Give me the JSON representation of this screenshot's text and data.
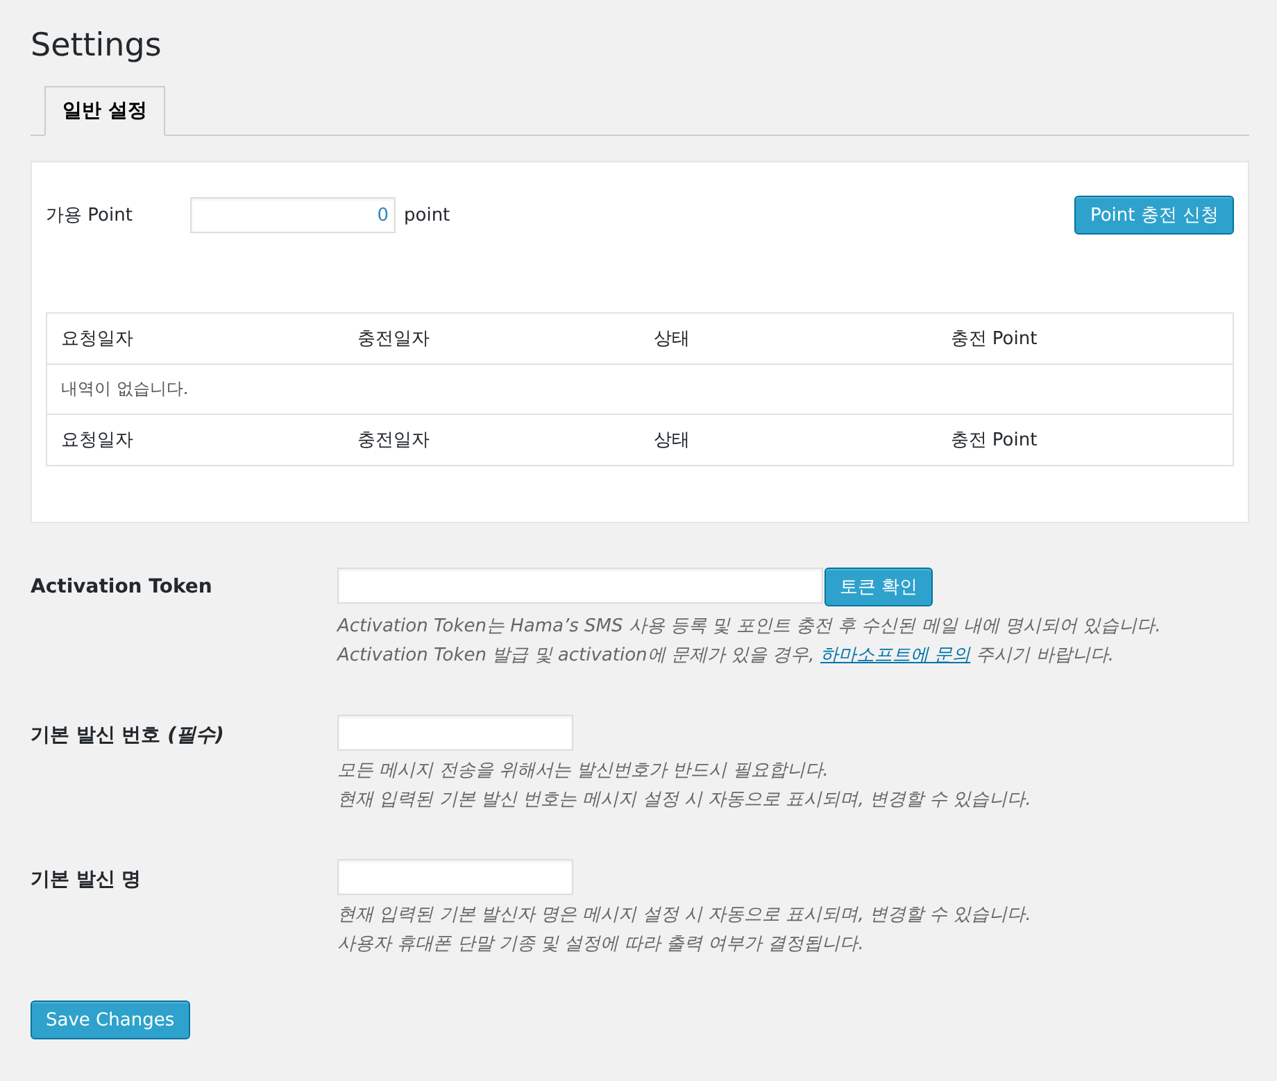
{
  "title": "Settings",
  "tabs": [
    {
      "label": "일반 설정",
      "selected": true
    }
  ],
  "points": {
    "label": "가용 Point",
    "value": "0",
    "unit": "point",
    "button": "Point 충전 신청"
  },
  "history": {
    "columns": [
      "요청일자",
      "충전일자",
      "상태",
      "충전 Point"
    ],
    "empty_message": "내역이 없습니다.",
    "footer": [
      "요청일자",
      "충전일자",
      "상태",
      "충전 Point"
    ]
  },
  "fields": [
    {
      "label": "Activation Token",
      "kind": "token",
      "button": "토큰 확인",
      "hints": [
        {
          "text": "Activation Token는 Hama’s SMS 사용 등록 및 포인트 충전 후 수신된 메일 내에 명시되어 있습니다."
        },
        {
          "text": "Activation Token 발급 및 activation에 문제가 있을 경우, ",
          "link": "하마소프트에 문의",
          "after": " 주시기 바랍니다."
        }
      ]
    },
    {
      "label": "기본 발신 번호 *(필수)*",
      "kind": "short",
      "hints": [
        {
          "text": "모든 메시지 전송을 위해서는 발신번호가 반드시 필요합니다."
        },
        {
          "text": "현재 입력된 기본 발신 번호는 메시지 설정 시 자동으로 표시되며, 변경할 수 있습니다."
        }
      ]
    },
    {
      "label": "기본 발신 명",
      "kind": "short",
      "hints": [
        {
          "text": "현재 입력된 기본 발신자 명은 메시지 설정 시 자동으로 표시되며, 변경할 수 있습니다."
        },
        {
          "text": "사용자 휴대폰 단말 기종 및 설정에 따라 출력 여부가 결정됩니다."
        }
      ]
    }
  ],
  "save_button": "Save Changes"
}
